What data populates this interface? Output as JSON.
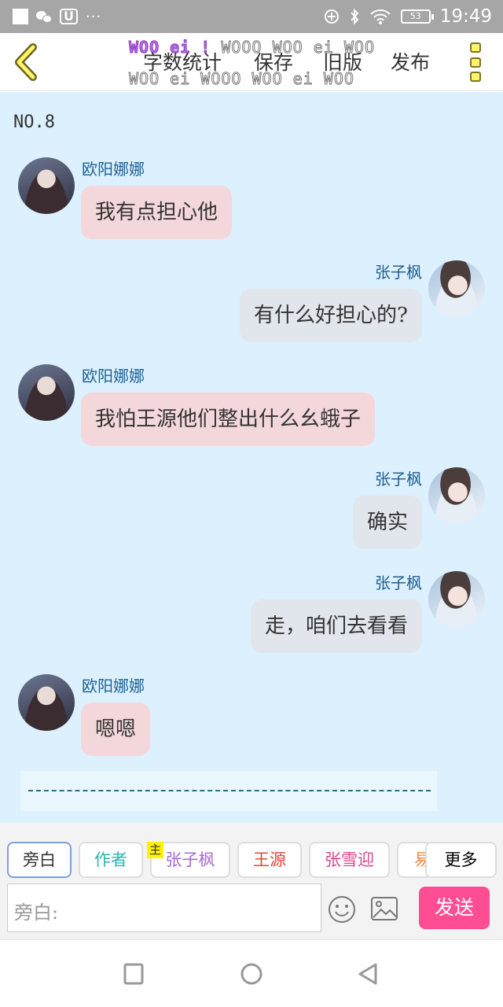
{
  "status_bar": {
    "app_badge": "U",
    "more_indicator": "···",
    "battery": "53",
    "time": "19:49",
    "icons": [
      "square-icon",
      "wechat-icon",
      "u-app-icon",
      "add-circle-icon",
      "bluetooth-icon",
      "wifi-icon",
      "battery-icon"
    ]
  },
  "topbar": {
    "watermark_row1_accent": "WOO ei !",
    "watermark_row1": "WOOO WOO ei WOO",
    "watermark_row2": "WOO ei WOOO WOO ei WOO",
    "word_count_label": "字数统计",
    "save_label": "保存",
    "old_version_label": "旧版",
    "publish_label": "发布",
    "accent_color": "#fff46a"
  },
  "chat": {
    "chapter_label": "NO.8",
    "background": "#dcf1fd",
    "messages": [
      {
        "side": "left",
        "name": "欧阳娜娜",
        "text": "我有点担心他"
      },
      {
        "side": "right",
        "name": "张子枫",
        "text": "有什么好担心的?"
      },
      {
        "side": "left",
        "name": "欧阳娜娜",
        "text": "我怕王源他们整出什么幺蛾子"
      },
      {
        "side": "right",
        "name": "张子枫",
        "text": "确实"
      },
      {
        "side": "right",
        "name": "张子枫",
        "text": "走，咱们去看看"
      },
      {
        "side": "left",
        "name": "欧阳娜娜",
        "text": "嗯嗯"
      }
    ],
    "aside_text": "___________________________________________"
  },
  "composer": {
    "chips": [
      {
        "label": "旁白",
        "color": "#333333"
      },
      {
        "label": "作者",
        "color": "#2bb5b0"
      },
      {
        "label": "张子枫",
        "color": "#a56bd6"
      },
      {
        "label": "王源",
        "color": "#e0443a"
      },
      {
        "label": "张雪迎",
        "color": "#e0448d"
      },
      {
        "label": "易",
        "color": "#f0873a"
      },
      {
        "label": "更多",
        "color": "#333333"
      }
    ],
    "main_badge": "主",
    "input_label": "旁白:",
    "send_label": "发送",
    "send_color": "#ff4d93"
  },
  "navbar": {
    "icons": [
      "recent-apps-icon",
      "home-icon",
      "back-nav-icon"
    ]
  }
}
